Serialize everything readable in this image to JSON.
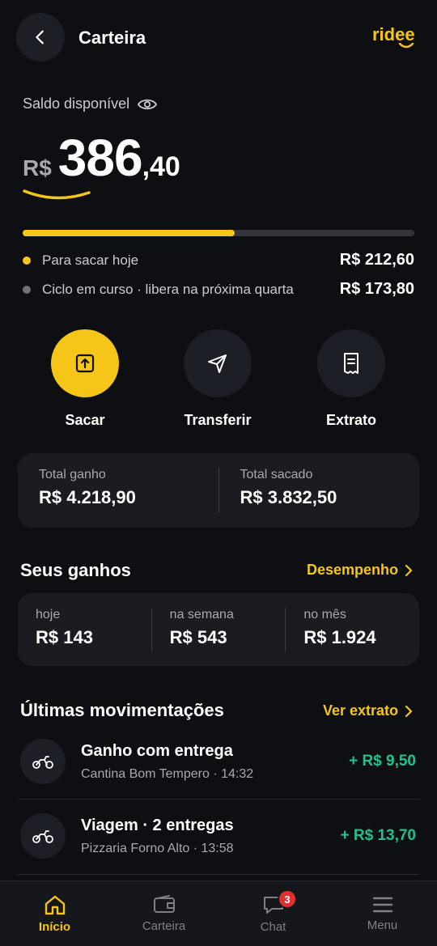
{
  "header": {
    "title": "Carteira",
    "logo": "ridee"
  },
  "balance": {
    "label": "Saldo disponível",
    "currency": "R$",
    "integer": "386",
    "decimal": ",40",
    "progress_fraction": 0.55
  },
  "breakdown": [
    {
      "label": "Para sacar hoje",
      "value": "R$ 212,60",
      "color": "#f5c518"
    },
    {
      "label": "Ciclo em curso · libera na próxima quarta",
      "value": "R$ 173,80",
      "color": "#6e7178"
    }
  ],
  "actions": [
    {
      "label": "Sacar",
      "icon": "upload-icon"
    },
    {
      "label": "Transferir",
      "icon": "send-icon"
    },
    {
      "label": "Extrato",
      "icon": "receipt-icon"
    }
  ],
  "totals": {
    "earned_label": "Total ganho",
    "earned_value": "R$ 4.218,90",
    "withdrawn_label": "Total sacado",
    "withdrawn_value": "R$ 3.832,50"
  },
  "earnings": {
    "title": "Seus ganhos",
    "link": "Desempenho",
    "periods": [
      {
        "label": "hoje",
        "value": "R$ 143"
      },
      {
        "label": "na semana",
        "value": "R$ 543"
      },
      {
        "label": "no mês",
        "value": "R$ 1.924"
      }
    ]
  },
  "movements": {
    "title": "Últimas movimentações",
    "link": "Ver extrato",
    "items": [
      {
        "title": "Ganho com entrega",
        "subtitle": "Cantina Bom Tempero · 14:32",
        "amount": "+ R$ 9,50"
      },
      {
        "title": "Viagem · 2 entregas",
        "subtitle": "Pizzaria Forno Alto · 13:58",
        "amount": "+ R$ 13,70"
      }
    ]
  },
  "nav": [
    {
      "label": "Início",
      "icon": "home-icon",
      "active": true
    },
    {
      "label": "Carteira",
      "icon": "wallet-icon"
    },
    {
      "label": "Chat",
      "icon": "chat-icon",
      "badge": "3"
    },
    {
      "label": "Menu",
      "icon": "menu-icon"
    }
  ],
  "colors": {
    "accent": "#f5c518",
    "positive": "#22c08a",
    "background": "#0e0f12"
  }
}
